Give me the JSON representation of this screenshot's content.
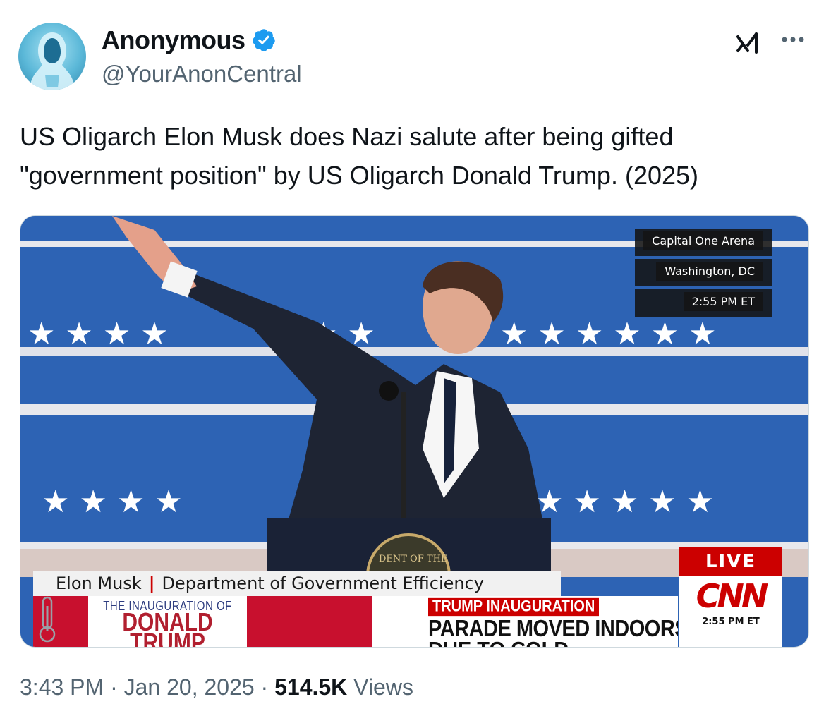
{
  "author": {
    "display_name": "Anonymous",
    "handle": "@YourAnonCentral",
    "verified": true
  },
  "header_icons": [
    "grok-icon",
    "more-options-icon"
  ],
  "tweet": {
    "text": "US Oligarch Elon Musk does Nazi salute after being gifted \"government position\" by US Oligarch Donald Trump. (2025)"
  },
  "media": {
    "venue_line1": "Capital One Arena",
    "venue_line2": "Washington, DC",
    "venue_time": "2:55 PM ET",
    "lower_third_name": "Elon Musk",
    "lower_third_separator": "|",
    "lower_third_title": "Department of Government Efficiency",
    "inaug_logo_small": "THE INAUGURATION OF",
    "inaug_logo_big": "DONALD",
    "inaug_logo_big2": "TRUMP",
    "headline_kicker": "TRUMP INAUGURATION",
    "headline_main": "PARADE MOVED INDOORS",
    "headline_main2": "DUE TO COLD",
    "live_label": "LIVE",
    "network_logo": "CNN",
    "network_time": "2:55 PM ET",
    "seal_text": "DENT OF THE",
    "colors": {
      "backdrop_blue": "#2d63b4",
      "cnn_red": "#cc0000",
      "verified_blue": "#1d9bf0"
    }
  },
  "meta": {
    "time": "3:43 PM",
    "sep1": " · ",
    "date": "Jan 20, 2025",
    "sep2": " · ",
    "views_count": "514.5K",
    "views_label": " Views"
  }
}
